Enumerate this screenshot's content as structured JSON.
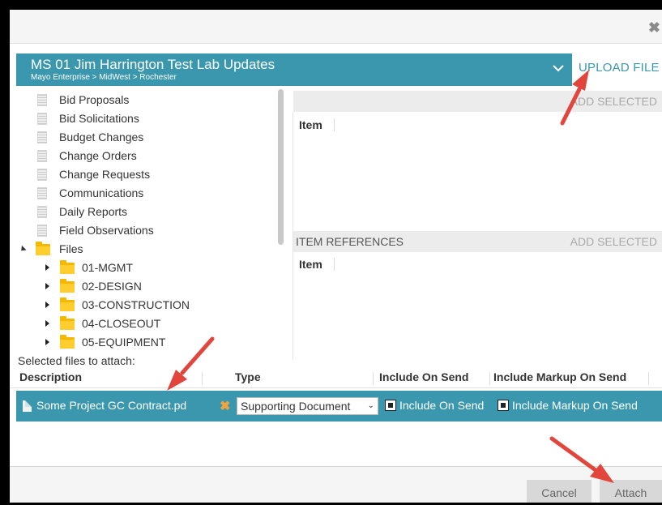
{
  "dialog": {
    "close_glyph": "✖",
    "project_title": "MS 01 Jim Harrington Test Lab Updates",
    "breadcrumb": "Mayo Enterprise > MidWest > Rochester",
    "upload_label": "UPLOAD FILE"
  },
  "tree": {
    "items": [
      {
        "label": "Bid Proposals"
      },
      {
        "label": "Bid Solicitations"
      },
      {
        "label": "Budget Changes"
      },
      {
        "label": "Change Orders"
      },
      {
        "label": "Change Requests"
      },
      {
        "label": "Communications"
      },
      {
        "label": "Daily Reports"
      },
      {
        "label": "Field Observations"
      }
    ],
    "files_label": "Files",
    "folders": [
      {
        "label": "01-MGMT"
      },
      {
        "label": "02-DESIGN"
      },
      {
        "label": "03-CONSTRUCTION"
      },
      {
        "label": "04-CLOSEOUT"
      },
      {
        "label": "05-EQUIPMENT"
      }
    ]
  },
  "items_panel": {
    "add_selected": "ADD SELECTED",
    "column": "Item"
  },
  "references_panel": {
    "title": "ITEM REFERENCES",
    "add_selected": "ADD SELECTED",
    "column": "Item"
  },
  "attachments": {
    "label": "Selected files to attach:",
    "columns": {
      "description": "Description",
      "type": "Type",
      "include_on_send": "Include On Send",
      "include_markup": "Include Markup On Send"
    },
    "row": {
      "file_name": "Some Project GC Contract.pd",
      "remove_glyph": "✖",
      "type_value": "Supporting Document",
      "include_on_send": "Include On Send",
      "include_markup": "Include Markup On Send"
    }
  },
  "footer": {
    "cancel": "Cancel",
    "attach": "Attach"
  },
  "colors": {
    "accent": "#3a97ad",
    "annotation_arrow": "#e2453c",
    "remove_icon": "#f0a340"
  }
}
